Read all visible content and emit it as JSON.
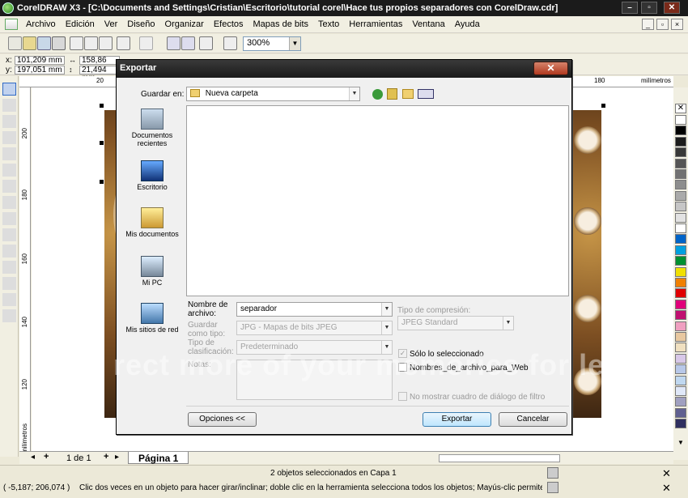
{
  "window": {
    "title": "CorelDRAW X3 - [C:\\Documents and Settings\\Cristian\\Escritorio\\tutorial corel\\Hace tus propios separadores con CorelDraw.cdr]",
    "minimize": "–",
    "maximize": "▫",
    "close": "✕"
  },
  "menu": {
    "items": [
      "Archivo",
      "Edición",
      "Ver",
      "Diseño",
      "Organizar",
      "Efectos",
      "Mapas de bits",
      "Texto",
      "Herramientas",
      "Ventana",
      "Ayuda"
    ]
  },
  "toolbar": {
    "zoom_value": "300%"
  },
  "propbar": {
    "x": "101,209 mm",
    "y": "197,051 mm",
    "w": "158,86 mm",
    "h": "21,494 mm"
  },
  "rulers": {
    "h_ticks": [
      "20",
      "180"
    ],
    "h_unit": "milímetros",
    "v_ticks": [
      "200",
      "180",
      "160",
      "140",
      "120"
    ],
    "v_unit": "milímetros"
  },
  "pagenav": {
    "current": "1 de 1",
    "tab": "Página 1"
  },
  "status": {
    "selection": "2 objetos seleccionados en Capa 1",
    "coords": "( -5,187; 206,074 )",
    "hint": "Clic dos veces en un objeto para hacer girar/inclinar; doble clic en la herramienta selecciona todos los objetos; Mayús-clic permite la selección ..."
  },
  "watermark": "rect more of your memories for le",
  "dialog": {
    "title": "Exportar",
    "close": "✕",
    "save_in_label": "Guardar en:",
    "save_in_value": "Nueva carpeta",
    "places": [
      {
        "label": "Documentos recientes",
        "icon": "recent-documents-icon"
      },
      {
        "label": "Escritorio",
        "icon": "desktop-icon"
      },
      {
        "label": "Mis documentos",
        "icon": "my-documents-icon"
      },
      {
        "label": "Mi PC",
        "icon": "my-computer-icon"
      },
      {
        "label": "Mis sitios de red",
        "icon": "network-places-icon"
      }
    ],
    "filename_label": "Nombre de archivo:",
    "filename_value": "separador",
    "saveas_label": "Guardar como tipo:",
    "saveas_value": "JPG - Mapas de bits JPEG",
    "sort_label": "Tipo de clasificación:",
    "sort_value": "Predeterminado",
    "notes_label": "Notas:",
    "compression_label": "Tipo de compresión:",
    "compression_value": "JPEG Standard",
    "only_selected": "Sólo lo seleccionado",
    "web_names": "Nombres_de_archivo_para_Web",
    "no_dialog": "No mostrar cuadro de diálogo de filtro",
    "options_button": "Opciones <<",
    "export_button": "Exportar",
    "cancel_button": "Cancelar"
  },
  "palette_colors": [
    "#ffffff",
    "#000000",
    "#1c1c1c",
    "#383838",
    "#555555",
    "#717171",
    "#8d8d8d",
    "#aaaaaa",
    "#c6c6c6",
    "#e2e2e2",
    "#ffffff",
    "#0064c8",
    "#00a0e0",
    "#009030",
    "#f0e000",
    "#f08000",
    "#e00000",
    "#e0007a",
    "#c01070",
    "#f0a0c0",
    "#e8c8a0",
    "#f0e0c0",
    "#d8c8e8",
    "#b8c8e8",
    "#c0d8f0",
    "#e0e8f8",
    "#a0a0c0",
    "#606090",
    "#303060"
  ]
}
